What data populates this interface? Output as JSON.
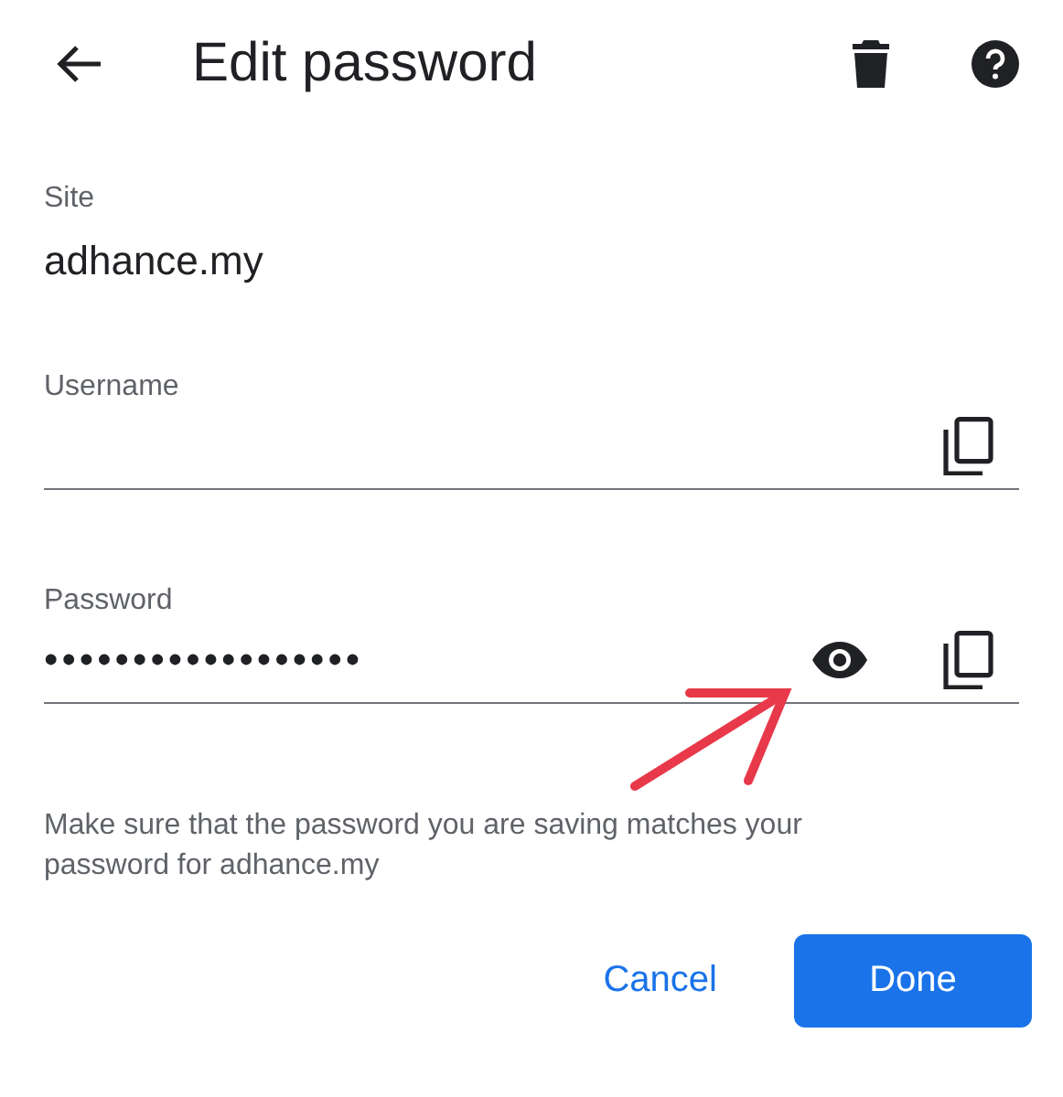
{
  "header": {
    "title": "Edit password"
  },
  "site": {
    "label": "Site",
    "value": "adhance.my"
  },
  "fields": [
    {
      "kind": "username",
      "label": "Username"
    },
    {
      "kind": "password",
      "label": "Password",
      "value": "••••••••••••••••••",
      "reveal": true
    }
  ],
  "note": "Make sure that the password you are saving matches your password for adhance.my",
  "buttons": [
    {
      "label": "Cancel",
      "primary": false
    },
    {
      "label": "Done",
      "primary": true
    }
  ]
}
